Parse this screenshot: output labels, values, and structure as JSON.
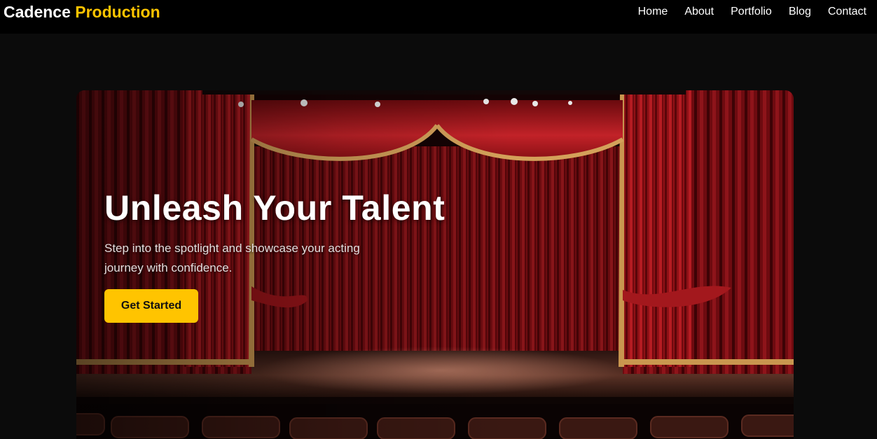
{
  "brand": {
    "name_first": "Cadence",
    "name_second": "Production"
  },
  "nav": {
    "links": [
      "Home",
      "About",
      "Portfolio",
      "Blog",
      "Contact"
    ]
  },
  "hero": {
    "title": "Unleash Your Talent",
    "subtitle": "Step into the spotlight and showcase your acting journey with confidence.",
    "cta_label": "Get Started"
  },
  "colors": {
    "accent": "#ffc400",
    "navbar_bg": "#000000",
    "page_bg": "#0b0b0b"
  }
}
